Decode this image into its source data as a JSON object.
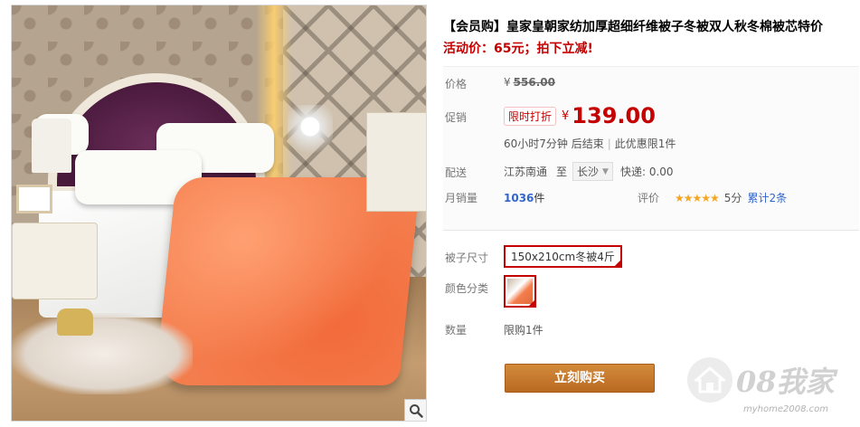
{
  "product": {
    "title": "【会员购】皇家皇朝家纺加厚超细纤维被子冬被双人秋冬棉被芯特价",
    "subtitle": "活动价：65元；拍下立减!"
  },
  "price": {
    "label": "价格",
    "currency": "¥",
    "original": "556.00"
  },
  "promo": {
    "label": "促销",
    "badge": "限时打折",
    "currency": "¥",
    "price": "139.00",
    "countdown": "60小时7分钟 后结束",
    "limit": "此优惠限1件"
  },
  "shipping": {
    "label": "配送",
    "from": "江苏南通",
    "to_word": "至",
    "destination": "长沙",
    "express": "快递: 0.00"
  },
  "sales": {
    "label": "月销量",
    "count": "1036",
    "unit": "件"
  },
  "rating": {
    "label": "评价",
    "stars": "★★★★★",
    "score": "5分",
    "total": "累计2条"
  },
  "sku": {
    "size_label": "被子尺寸",
    "size_value": "150x210cm冬被4斤",
    "color_label": "颜色分类"
  },
  "quantity": {
    "label": "数量",
    "limit": "限购1件"
  },
  "buy_button": "立刻购买",
  "watermark": {
    "brand": "08我家",
    "url": "myhome2008.com"
  },
  "colors": {
    "accent_red": "#c40000",
    "buy_button": "#b96a22",
    "link_blue": "#3366cc",
    "star": "#f5a623"
  },
  "icons": [
    "zoom-icon",
    "caret-down-icon",
    "check-corner-icon",
    "house-icon"
  ]
}
